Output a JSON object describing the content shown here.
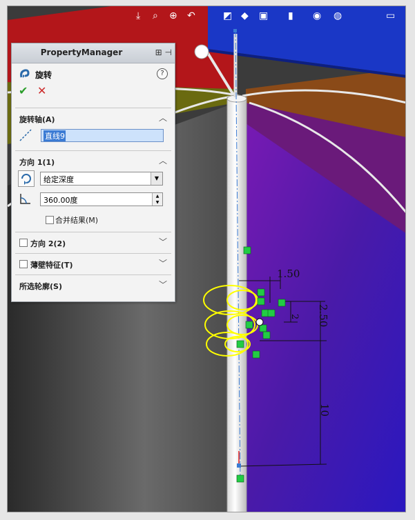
{
  "window": {
    "accent_color": "#3b7bd4"
  },
  "toolbar": {
    "icons": [
      "view-orientation-icon",
      "zoom-to-fit-icon",
      "zoom-area-icon",
      "previous-view-icon",
      "section-view-icon",
      "view-selector-icon",
      "display-style-icon",
      "hide-show-icon",
      "appearance-icon",
      "scene-icon",
      "display-settings-icon"
    ]
  },
  "property_manager": {
    "title": "PropertyManager",
    "feature_name": "旋转",
    "help_label": "?",
    "ok_label": "✔",
    "cancel_label": "✕",
    "axis_group": {
      "title": "旋转轴(A)",
      "selection": "直线9"
    },
    "direction1_group": {
      "title": "方向 1(1)",
      "end_condition": "给定深度",
      "angle_value": "360.00度",
      "merge_label": "合并结果(M)"
    },
    "direction2_group": {
      "title": "方向 2(2)"
    },
    "thin_feature_group": {
      "title": "薄壁特征(T)"
    },
    "contours_group": {
      "title": "所选轮廓(S)"
    }
  },
  "sketch_dimensions": {
    "d1": "1.50",
    "d2": "2",
    "d3": "2.50",
    "d4": "10"
  },
  "colors": {
    "red_panel": "#b3161a",
    "blue_panel": "#1a37c6",
    "olive_panel": "#6a6a10",
    "purple_panel": "#5a1a9a",
    "sketch_yellow": "#ffff00",
    "relation_green": "#22cc44"
  }
}
